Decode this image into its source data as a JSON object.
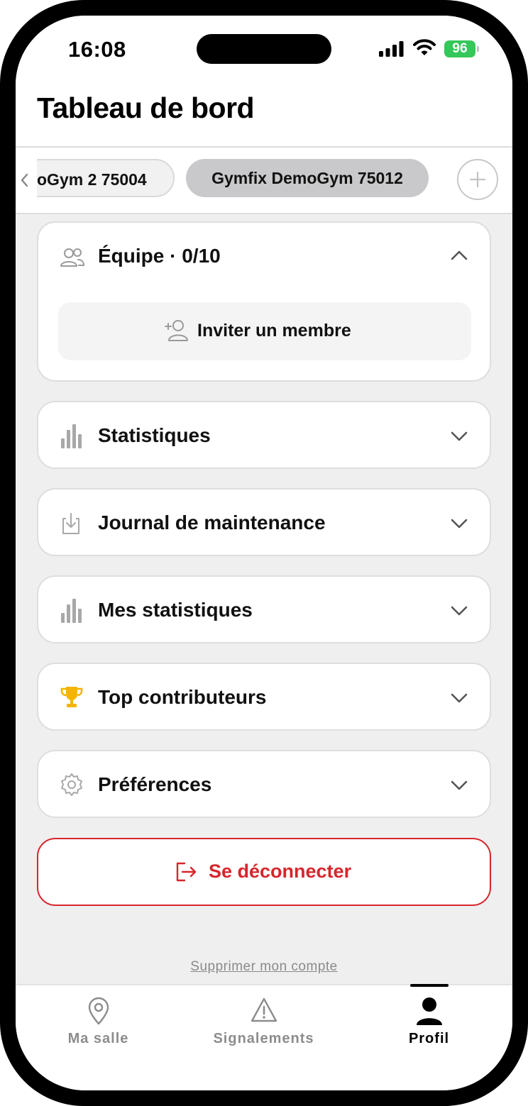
{
  "status_bar": {
    "time": "16:08",
    "battery": "96"
  },
  "header": {
    "title": "Tableau de bord"
  },
  "gym_tabs": [
    {
      "label": "oGym 2 75004",
      "selected": false
    },
    {
      "label": "Gymfix DemoGym 75012",
      "selected": true
    }
  ],
  "team": {
    "title": "Équipe · 0/10",
    "invite_label": "Inviter un membre"
  },
  "sections": [
    {
      "label": "Statistiques",
      "icon": "bar-chart-icon"
    },
    {
      "label": "Journal de maintenance",
      "icon": "download-icon"
    },
    {
      "label": "Mes statistiques",
      "icon": "bar-chart-icon"
    },
    {
      "label": "Top contributeurs",
      "icon": "trophy-icon"
    },
    {
      "label": "Préférences",
      "icon": "gear-icon"
    }
  ],
  "logout": {
    "label": "Se déconnecter"
  },
  "delete_account": {
    "label": "Supprimer mon compte"
  },
  "tabbar": [
    {
      "label": "Ma salle",
      "icon": "location-pin-icon",
      "active": false
    },
    {
      "label": "Signalements",
      "icon": "warning-icon",
      "active": false
    },
    {
      "label": "Profil",
      "icon": "person-icon",
      "active": true
    }
  ],
  "colors": {
    "accent_red": "#d7262c",
    "trophy": "#f5b400",
    "battery": "#34c759",
    "chip_selected": "#c9c9cb"
  }
}
